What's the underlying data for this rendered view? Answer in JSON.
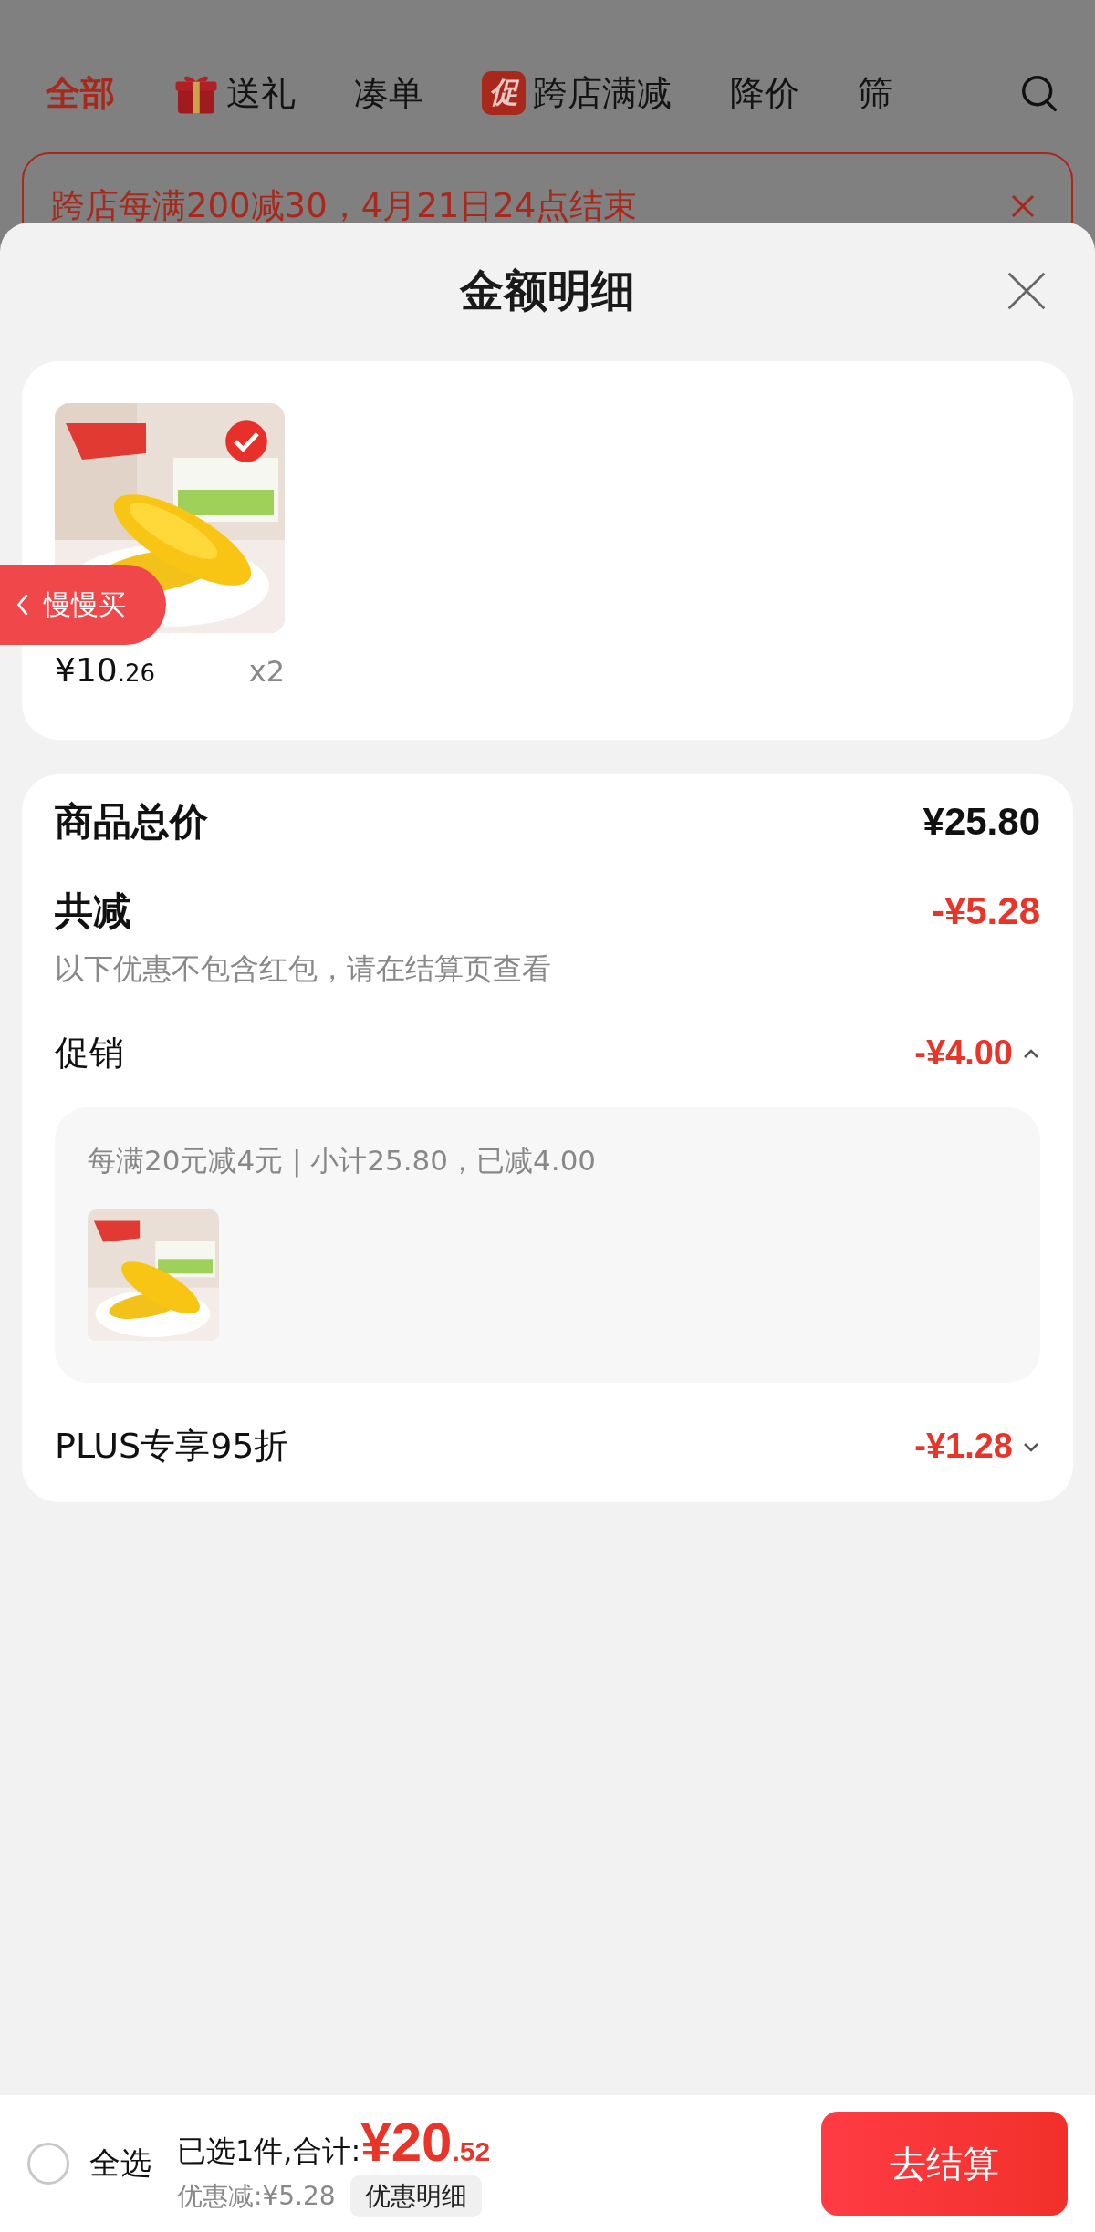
{
  "tabs": [
    {
      "label": "全部",
      "selected": true,
      "kind": "plain"
    },
    {
      "label": "送礼",
      "selected": false,
      "kind": "gift"
    },
    {
      "label": "凑单",
      "selected": false,
      "kind": "plain"
    },
    {
      "label": "跨店满减",
      "selected": false,
      "kind": "badge",
      "badge": "促"
    },
    {
      "label": "降价",
      "selected": false,
      "kind": "plain"
    },
    {
      "label": "筛",
      "selected": false,
      "kind": "plain"
    }
  ],
  "banner": {
    "text": "跨店每满200减30，4月21日24点结束"
  },
  "sheet": {
    "title": "金额明细"
  },
  "product": {
    "checked": true,
    "price_integer": "¥10",
    "price_decimal": ".26",
    "quantity": "x2",
    "side_tab": "慢慢买"
  },
  "summary": {
    "total_label": "商品总价",
    "total": "¥25.80",
    "discount_label": "共减",
    "discount": "-¥5.28",
    "note": "以下优惠不包含红包，请在结算页查看",
    "promotions": [
      {
        "label": "促销",
        "amount": "-¥4.00",
        "expanded": true,
        "rule": "每满20元减4元 | 小计25.80，已减4.00"
      },
      {
        "label": "PLUS专享95折",
        "amount": "-¥1.28",
        "expanded": false
      }
    ]
  },
  "bottom_bar": {
    "select_all": {
      "label": "全选",
      "checked": false
    },
    "selected_text": "已选1件,合计:",
    "total_integer": "¥20",
    "total_decimal": ".52",
    "saved": "优惠减:¥5.28",
    "details_button": "优惠明细",
    "checkout_button": "去结算"
  }
}
